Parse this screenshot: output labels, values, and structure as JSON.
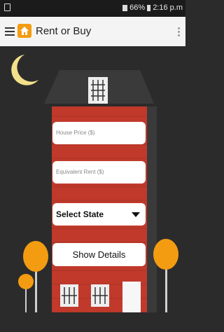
{
  "status_bar": {
    "battery": "66%",
    "time": "2:16 p.m"
  },
  "app_bar": {
    "title": "Rent or Buy"
  },
  "form": {
    "house_price_placeholder": "House Price ($)",
    "equivalent_rent_placeholder": "Equivalent Rent ($)",
    "state_select_value": "Select State",
    "show_details_label": "Show Details"
  },
  "colors": {
    "brick": "#c0392b",
    "roof": "#3a3a3a",
    "background": "#2b2b2b",
    "moon": "#f3e08a",
    "tree": "#f39c12",
    "app_icon": "#f39c12"
  },
  "icons": [
    "hamburger-icon",
    "home-icon",
    "overflow-menu-icon",
    "dropdown-triangle-icon"
  ]
}
